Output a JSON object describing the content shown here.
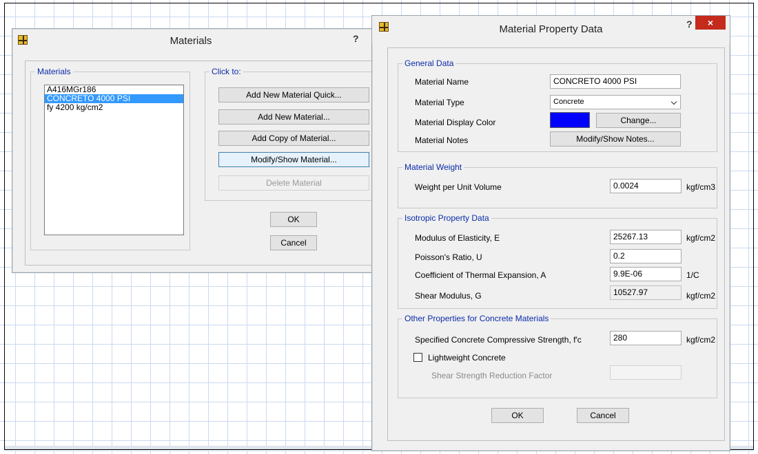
{
  "materials_dialog": {
    "title": "Materials",
    "help_glyph": "?",
    "materials_group_label": "Materials",
    "click_to_label": "Click to:",
    "materials_list": [
      "A416MGr186",
      "CONCRETO 4000 PSI",
      "fy 4200 kg/cm2"
    ],
    "selected_index": 1,
    "buttons": {
      "add_quick": "Add New Material Quick...",
      "add_new": "Add New Material...",
      "add_copy": "Add Copy of Material...",
      "modify_show": "Modify/Show Material...",
      "delete": "Delete Material",
      "ok": "OK",
      "cancel": "Cancel"
    }
  },
  "property_dialog": {
    "title": "Material Property Data",
    "help_glyph": "?",
    "close_glyph": "×",
    "general": {
      "group_label": "General Data",
      "name_label": "Material Name",
      "name_value": "CONCRETO 4000 PSI",
      "type_label": "Material Type",
      "type_value": "Concrete",
      "color_label": "Material Display Color",
      "color_value": "#0000ff",
      "change_button": "Change...",
      "notes_label": "Material Notes",
      "notes_button": "Modify/Show Notes..."
    },
    "weight": {
      "group_label": "Material Weight",
      "label": "Weight per Unit Volume",
      "value": "0.0024",
      "unit": "kgf/cm3"
    },
    "isotropic": {
      "group_label": "Isotropic Property Data",
      "e_label": "Modulus of Elasticity,  E",
      "e_value": "25267.13",
      "e_unit": "kgf/cm2",
      "u_label": "Poisson's Ratio,  U",
      "u_value": "0.2",
      "a_label": "Coefficient of Thermal Expansion,  A",
      "a_value": "9.9E-06",
      "a_unit": "1/C",
      "g_label": "Shear Modulus,  G",
      "g_value": "10527.97",
      "g_unit": "kgf/cm2"
    },
    "concrete": {
      "group_label": "Other Properties for Concrete Materials",
      "fc_label": "Specified Concrete Compressive Strength, f'c",
      "fc_value": "280",
      "fc_unit": "kgf/cm2",
      "lightweight_label": "Lightweight Concrete",
      "lightweight_checked": false,
      "reduction_label": "Shear Strength Reduction Factor",
      "reduction_value": ""
    },
    "buttons": {
      "ok": "OK",
      "cancel": "Cancel"
    }
  }
}
